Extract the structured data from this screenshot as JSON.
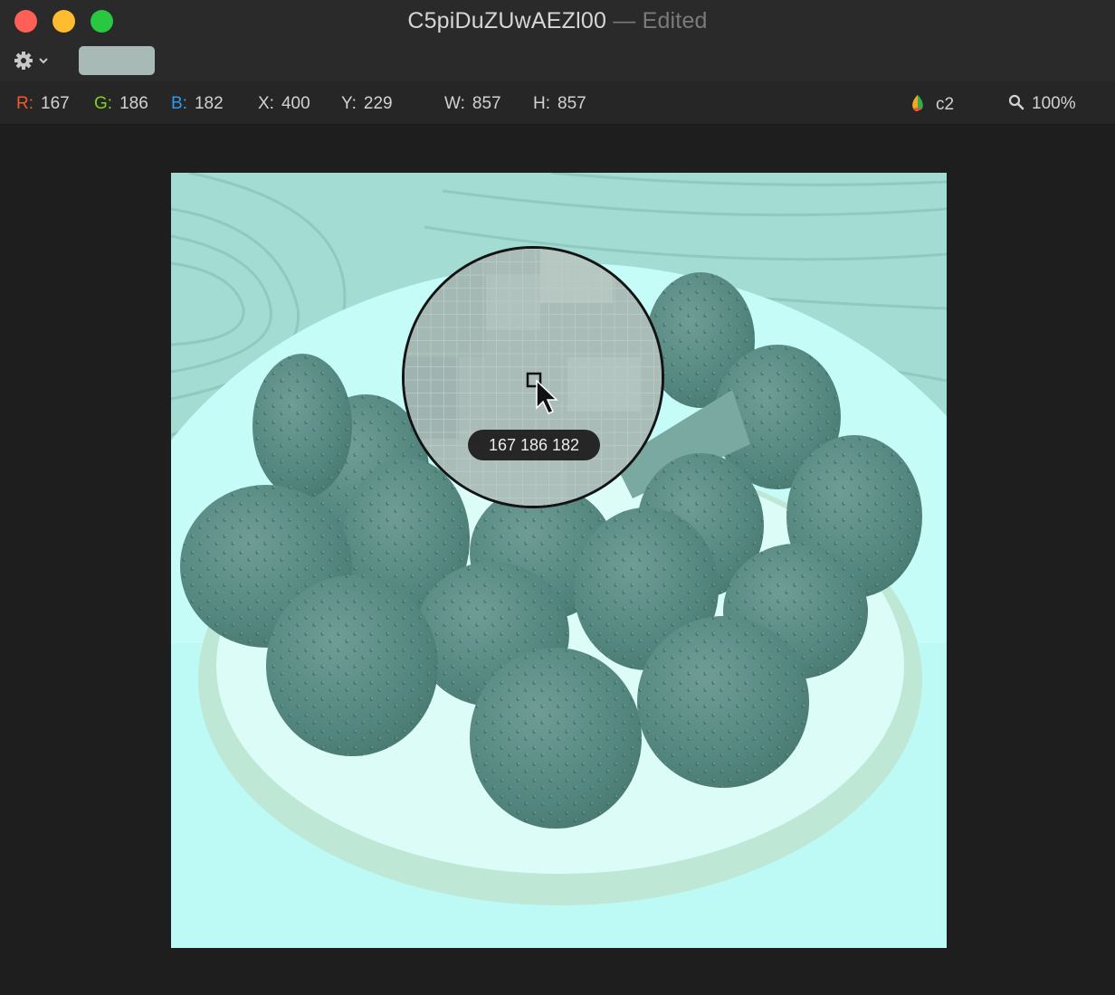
{
  "window": {
    "title": "C5piDuZUwAEZl00",
    "status": "Edited",
    "separator": "—"
  },
  "toolbar": {
    "gear_icon": "gear-icon",
    "dropdown_icon": "chevron-down-icon",
    "swatch_color": "#a7bab6"
  },
  "info": {
    "r_label": "R:",
    "r_value": "167",
    "r_color": "#f2592b",
    "g_label": "G:",
    "g_value": "186",
    "g_color": "#7ed321",
    "b_label": "B:",
    "b_value": "182",
    "b_color": "#2f9bf0",
    "x_label": "X:",
    "x_value": "400",
    "y_label": "Y:",
    "y_value": "229",
    "w_label": "W:",
    "w_value": "857",
    "h_label": "H:",
    "h_value": "857",
    "profile_icon": "color-profile-icon",
    "profile_label": "c2",
    "zoom_icon": "magnifier-icon",
    "zoom_label": "100%"
  },
  "loupe": {
    "readout": "167 186 182",
    "cursor_icon": "arrow-cursor-icon"
  },
  "image": {
    "description_colors": {
      "background": "#b8f7f2",
      "table_wood": "#9fd9cf",
      "plate": "#c4fbf8",
      "strawberry": "#5c8f87",
      "crust": "#bfe9d9"
    }
  }
}
